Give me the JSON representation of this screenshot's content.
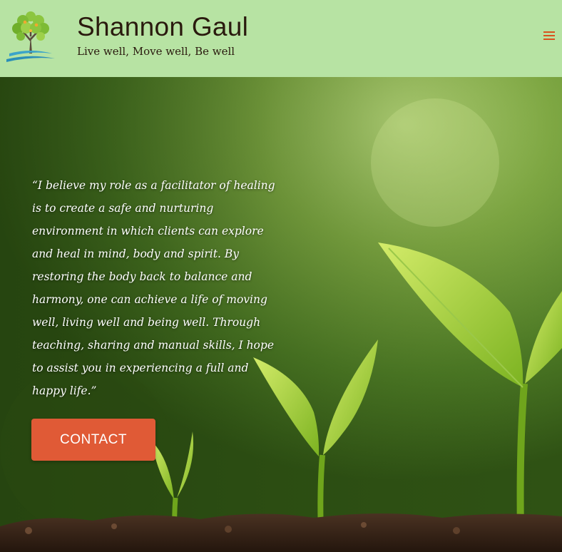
{
  "header": {
    "site_title": "Shannon Gaul",
    "tagline": "Live well, Move well, Be well",
    "logo_icon": "tree-logo-icon",
    "menu_icon": "hamburger-menu-icon",
    "accent_color": "#d9531e",
    "background_color": "#b7e3a3"
  },
  "hero": {
    "quote": "“I believe my role as a facilitator of healing is to create a safe and nurturing environment in which clients can explore and heal in mind, body and spirit. By restoring the body back to balance and harmony, one can achieve a life of moving well, living well and being well. Through teaching, sharing and manual skills, I hope to assist you in experiencing a full and happy life.”",
    "button_label": "CONTACT",
    "button_color": "#e05a36",
    "background_image": "seedlings-growing-in-soil"
  }
}
